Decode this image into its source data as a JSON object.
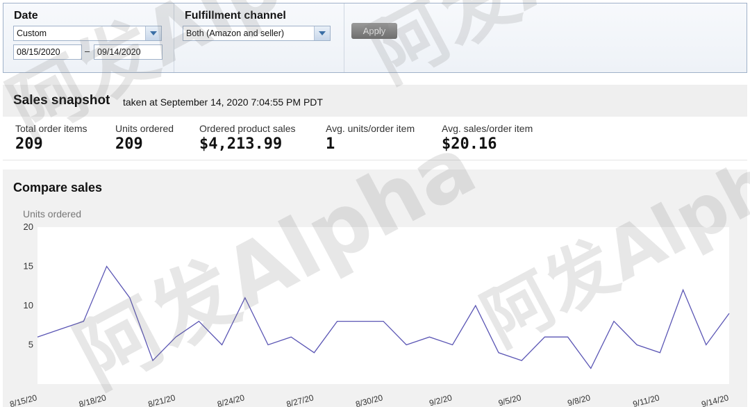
{
  "filters": {
    "date_label": "Date",
    "date_select_value": "Custom",
    "date_from": "08/15/2020",
    "date_separator": "–",
    "date_to": "09/14/2020",
    "channel_label": "Fulfillment channel",
    "channel_select_value": "Both (Amazon and seller)",
    "apply_label": "Apply"
  },
  "snapshot": {
    "title": "Sales snapshot",
    "subtitle": "taken at September 14, 2020 7:04:55 PM PDT",
    "metrics": [
      {
        "label": "Total order items",
        "value": "209"
      },
      {
        "label": "Units ordered",
        "value": "209"
      },
      {
        "label": "Ordered product sales",
        "value": "$4,213.99"
      },
      {
        "label": "Avg. units/order item",
        "value": "1"
      },
      {
        "label": "Avg. sales/order item",
        "value": "$20.16"
      }
    ]
  },
  "compare": {
    "title": "Compare sales"
  },
  "watermark": {
    "text": "阿发Alpha"
  },
  "chart_data": {
    "type": "line",
    "title": "",
    "xlabel": "",
    "ylabel": "Units ordered",
    "ylim": [
      0,
      20
    ],
    "yticks": [
      5,
      10,
      15,
      20
    ],
    "x": [
      "8/15/20",
      "8/16/20",
      "8/17/20",
      "8/18/20",
      "8/19/20",
      "8/20/20",
      "8/21/20",
      "8/22/20",
      "8/23/20",
      "8/24/20",
      "8/25/20",
      "8/26/20",
      "8/27/20",
      "8/28/20",
      "8/29/20",
      "8/30/20",
      "8/31/20",
      "9/1/20",
      "9/2/20",
      "9/3/20",
      "9/4/20",
      "9/5/20",
      "9/6/20",
      "9/7/20",
      "9/8/20",
      "9/9/20",
      "9/10/20",
      "9/11/20",
      "9/12/20",
      "9/13/20",
      "9/14/20"
    ],
    "xtick_labels": [
      "8/15/20",
      "8/18/20",
      "8/21/20",
      "8/24/20",
      "8/27/20",
      "8/30/20",
      "9/2/20",
      "9/5/20",
      "9/8/20",
      "9/11/20",
      "9/14/20"
    ],
    "series": [
      {
        "color": "#5a55b4",
        "values": [
          6,
          7,
          8,
          15,
          11,
          3,
          6,
          8,
          5,
          11,
          5,
          6,
          4,
          8,
          8,
          8,
          5,
          6,
          5,
          10,
          4,
          3,
          6,
          6,
          2,
          8,
          5,
          4,
          12,
          5,
          9
        ]
      }
    ],
    "grid": false,
    "legend": "none"
  }
}
